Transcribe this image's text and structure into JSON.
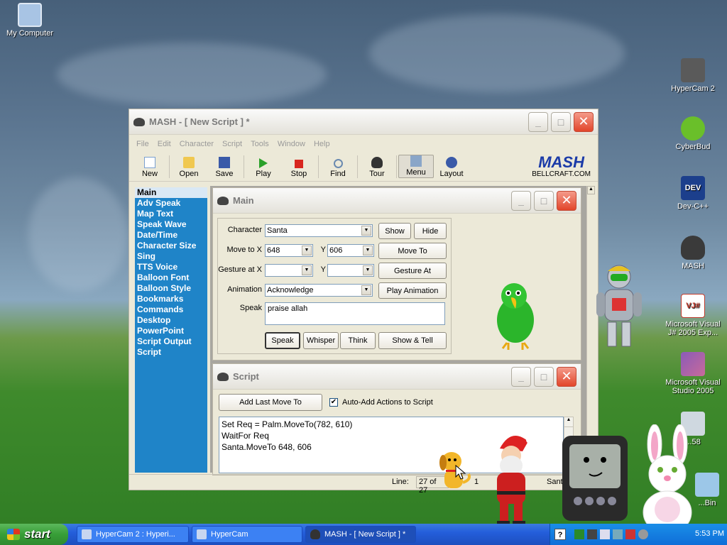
{
  "desktop": {
    "icons": [
      {
        "label": "My Computer"
      },
      {
        "label": "HyperCam 2"
      },
      {
        "label": "CyberBud"
      },
      {
        "label": "Dev-C++"
      },
      {
        "label": "MASH"
      },
      {
        "label": "Microsoft Visual J# 2005 Exp..."
      },
      {
        "label": "Microsoft Visual Studio 2005"
      },
      {
        "label": "...58"
      },
      {
        "label": "...Bin"
      }
    ],
    "dev_badge": "DEV",
    "vjs_badge": "VJ#"
  },
  "mash": {
    "title": "MASH - [ New Script ] *",
    "menu": [
      "File",
      "Edit",
      "Character",
      "Script",
      "Tools",
      "Window",
      "Help"
    ],
    "toolbar": [
      "New",
      "Open",
      "Save",
      "Play",
      "Stop",
      "Find",
      "Tour",
      "Menu",
      "Layout"
    ],
    "logo": {
      "name": "MASH",
      "url": "BELLCRAFT.COM"
    },
    "nav_items": [
      "Main",
      "Adv Speak",
      "Map Text",
      "Speak Wave",
      "Date/Time",
      "Character Size",
      "Sing",
      "TTS Voice",
      "Balloon Font",
      "Balloon Style",
      "Bookmarks",
      "Commands",
      "Desktop",
      "PowerPoint",
      "Script Output",
      "Script"
    ],
    "status": {
      "line_label": "Line:",
      "line_value": "27 of 27",
      "col_value": "1",
      "character": "Sant"
    }
  },
  "main_panel": {
    "title": "Main",
    "character_label": "Character",
    "character_value": "Santa",
    "show_button": "Show",
    "hide_button": "Hide",
    "moveto_label": "Move to X",
    "moveto_x": "648",
    "y_label": "Y",
    "moveto_y": "606",
    "moveto_button": "Move To",
    "gesture_label": "Gesture at X",
    "gesture_x": "",
    "gesture_y": "",
    "gesture_button": "Gesture At",
    "animation_label": "Animation",
    "animation_value": "Acknowledge",
    "play_animation_button": "Play Animation",
    "speak_label": "Speak",
    "speak_text": "praise allah",
    "speak_button": "Speak",
    "whisper_button": "Whisper",
    "think_button": "Think",
    "show_tell_button": "Show & Tell"
  },
  "script_panel": {
    "title": "Script",
    "add_last_button": "Add Last Move To",
    "auto_add_label": "Auto-Add Actions to Script",
    "auto_add_checked": true,
    "lines": [
      "Set Req = Palm.MoveTo(782, 610)",
      "WaitFor Req",
      "Santa.MoveTo 648, 606"
    ]
  },
  "taskbar": {
    "start_label": "start",
    "tasks": [
      {
        "label": "HyperCam 2 : Hyperi..."
      },
      {
        "label": "HyperCam"
      },
      {
        "label": "MASH - [ New Script ] *"
      }
    ],
    "help_glyph": "?",
    "clock": "5:53 PM"
  },
  "colors": {
    "nav_bg": "#1f84c8",
    "taskbar": "#245edb",
    "start": "#379e37"
  }
}
